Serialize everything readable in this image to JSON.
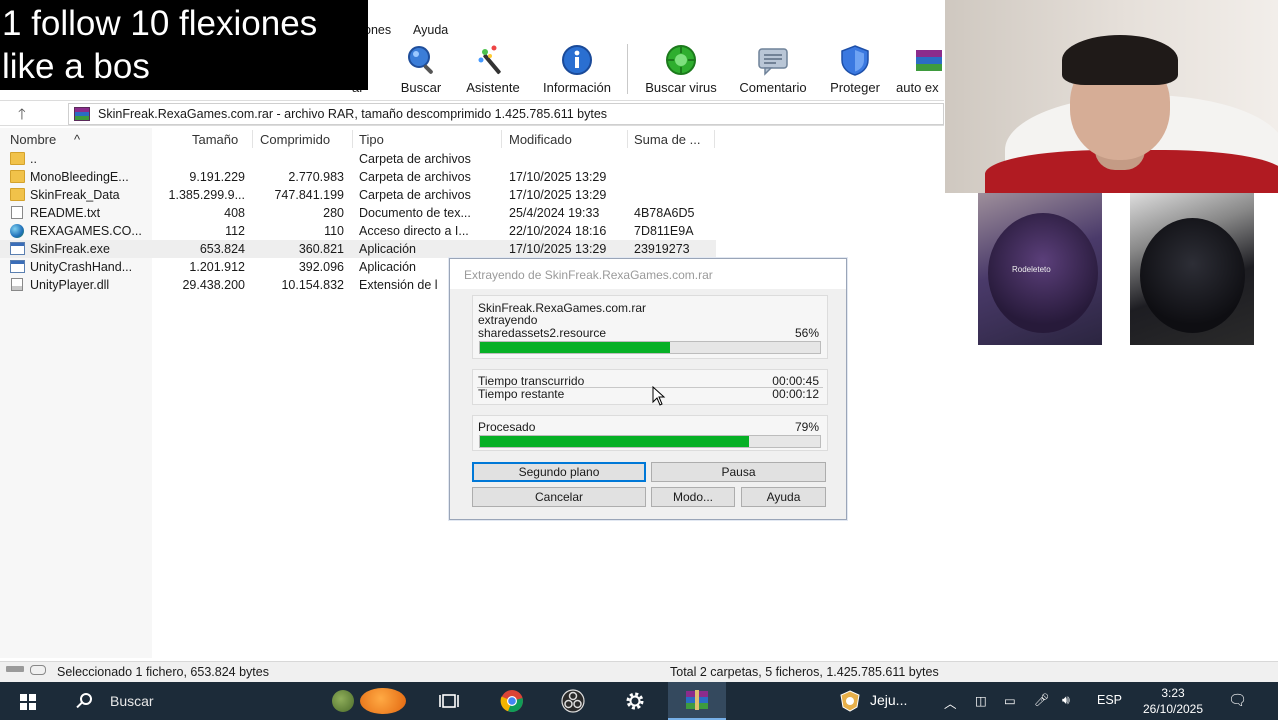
{
  "overlay": {
    "caption_line1": "1 follow 10 flexiones",
    "caption_line2": "like a bos"
  },
  "menubar": {
    "items": [
      "ones",
      "Ayuda"
    ]
  },
  "toolbar": {
    "items": [
      {
        "label": "ar",
        "icon": "partial-tool-icon"
      },
      {
        "label": "Buscar",
        "icon": "magnifier-icon"
      },
      {
        "label": "Asistente",
        "icon": "magic-wand-icon"
      },
      {
        "label": "Información",
        "icon": "info-icon"
      },
      {
        "label": "Buscar virus",
        "icon": "virus-scan-icon"
      },
      {
        "label": "Comentario",
        "icon": "comment-icon"
      },
      {
        "label": "Proteger",
        "icon": "shield-icon"
      },
      {
        "label": "auto ex",
        "icon": "sfx-books-icon"
      }
    ]
  },
  "addressbar": {
    "text": "SkinFreak.RexaGames.com.rar - archivo RAR, tamaño descomprimido 1.425.785.611 bytes"
  },
  "filelist": {
    "columns": [
      "Nombre",
      "Tamaño",
      "Comprimido",
      "Tipo",
      "Modificado",
      "Suma de ..."
    ],
    "rows": [
      {
        "icon": "folder",
        "name": "..",
        "size": "",
        "compressed": "",
        "type": "Carpeta de archivos",
        "modified": "",
        "crc": ""
      },
      {
        "icon": "folder",
        "name": "MonoBleedingE...",
        "size": "9.191.229",
        "compressed": "2.770.983",
        "type": "Carpeta de archivos",
        "modified": "17/10/2025 13:29",
        "crc": ""
      },
      {
        "icon": "folder",
        "name": "SkinFreak_Data",
        "size": "1.385.299.9...",
        "compressed": "747.841.199",
        "type": "Carpeta de archivos",
        "modified": "17/10/2025 13:29",
        "crc": ""
      },
      {
        "icon": "file",
        "name": "README.txt",
        "size": "408",
        "compressed": "280",
        "type": "Documento de tex...",
        "modified": "25/4/2024 19:33",
        "crc": "4B78A6D5"
      },
      {
        "icon": "globe",
        "name": "REXAGAMES.CO...",
        "size": "112",
        "compressed": "110",
        "type": "Acceso directo a I...",
        "modified": "22/10/2024 18:16",
        "crc": "7D811E9A"
      },
      {
        "icon": "app",
        "name": "SkinFreak.exe",
        "size": "653.824",
        "compressed": "360.821",
        "type": "Aplicación",
        "modified": "17/10/2025 13:29",
        "crc": "23919273"
      },
      {
        "icon": "app",
        "name": "UnityCrashHand...",
        "size": "1.201.912",
        "compressed": "392.096",
        "type": "Aplicación",
        "modified": "",
        "crc": ""
      },
      {
        "icon": "dll",
        "name": "UnityPlayer.dll",
        "size": "29.438.200",
        "compressed": "10.154.832",
        "type": "Extensión de l",
        "modified": "",
        "crc": ""
      }
    ],
    "selected_index": 5
  },
  "statusbar": {
    "left": "Seleccionado 1 fichero, 653.824 bytes",
    "right": "Total 2 carpetas, 5 ficheros, 1.425.785.611 bytes"
  },
  "dialog": {
    "title": "Extrayendo de SkinFreak.RexaGames.com.rar",
    "archive": "SkinFreak.RexaGames.com.rar",
    "action": "extrayendo",
    "current_file": "sharedassets2.resource",
    "file_percent_text": "56%",
    "file_progress": 0.56,
    "elapsed_label": "Tiempo transcurrido",
    "elapsed_value": "00:00:45",
    "remaining_label": "Tiempo restante",
    "remaining_value": "00:00:12",
    "processed_label": "Procesado",
    "processed_percent_text": "79%",
    "processed_progress": 0.79,
    "buttons": {
      "background": "Segundo plano",
      "pause": "Pausa",
      "cancel": "Cancelar",
      "mode": "Modo...",
      "help": "Ayuda"
    }
  },
  "webcam": {
    "reel_label": "Rodeleteto"
  },
  "taskbar": {
    "search_text": "Buscar",
    "pinned": [
      "task-view-icon",
      "chrome-icon",
      "obs-icon",
      "settings-gear-icon",
      "winrar-icon"
    ],
    "jeju_label": "Jeju...",
    "language": "ESP",
    "time": "3:23",
    "date": "26/10/2025"
  },
  "colors": {
    "progress_green": "#06b025",
    "taskbar": "#1c2b39",
    "accent_blue": "#0078d7"
  }
}
